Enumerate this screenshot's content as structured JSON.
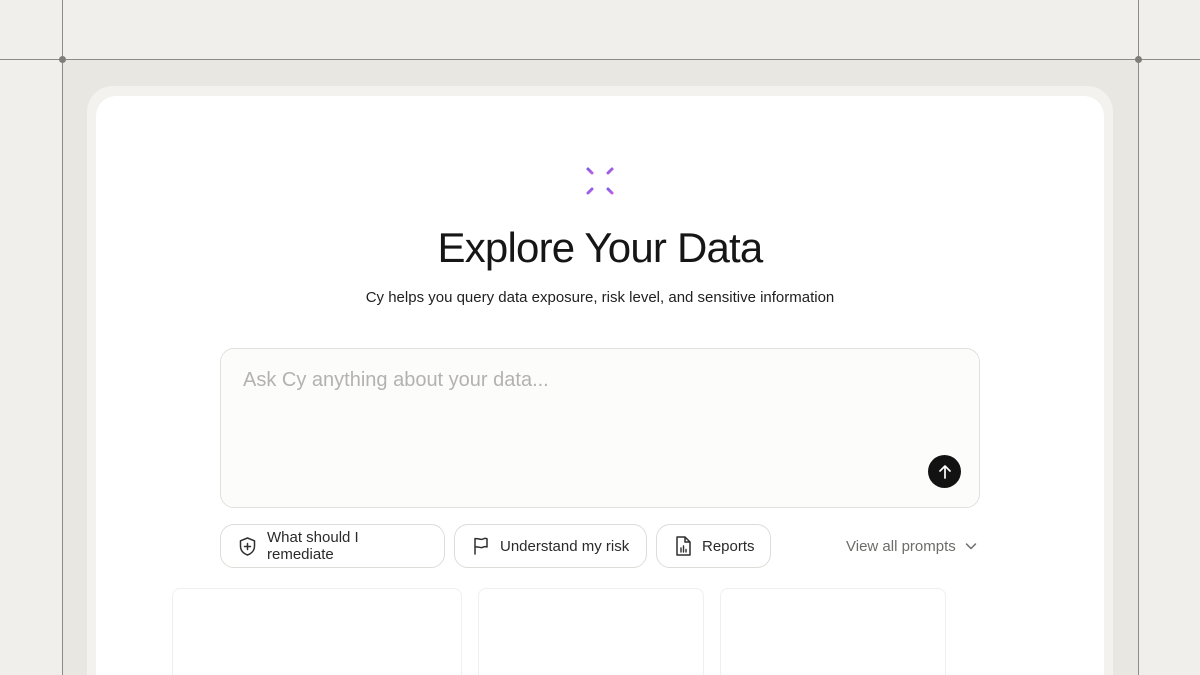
{
  "hero": {
    "icon": "sparkle-icon",
    "title": "Explore Your Data",
    "subtitle": "Cy helps you query data exposure, risk level, and sensitive information"
  },
  "prompt": {
    "placeholder": "Ask Cy anything about your data...",
    "value": "",
    "send_icon": "arrow-up-icon"
  },
  "suggestions": [
    {
      "label": "What should I remediate",
      "icon": "shield-plus-icon"
    },
    {
      "label": "Understand my risk",
      "icon": "flag-icon"
    },
    {
      "label": "Reports",
      "icon": "report-file-icon"
    }
  ],
  "view_all": {
    "label": "View all prompts",
    "icon": "chevron-down-icon"
  },
  "colors": {
    "accent": "#9b5de5",
    "background": "#f0efeb",
    "card": "#ffffff",
    "send_button": "#121212"
  }
}
